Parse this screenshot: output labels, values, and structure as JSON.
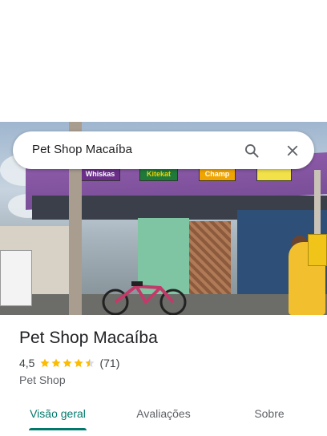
{
  "search": {
    "query": "Pet Shop Macaíba",
    "search_icon": "search-icon",
    "close_icon": "close-icon"
  },
  "place": {
    "title": "Pet Shop Macaíba",
    "rating": "4,5",
    "stars": 4.5,
    "review_count": "(71)",
    "category": "Pet Shop"
  },
  "tabs": [
    {
      "label": "Visão geral",
      "selected": true
    },
    {
      "label": "Avaliações",
      "selected": false
    },
    {
      "label": "Sobre",
      "selected": false
    }
  ],
  "colors": {
    "accent": "#00796b",
    "star": "#fbbc04",
    "text_primary": "#202124",
    "text_secondary": "#5f6368"
  },
  "photo": {
    "signs": [
      "Whiskas",
      "Kitekat",
      "Champ"
    ]
  }
}
